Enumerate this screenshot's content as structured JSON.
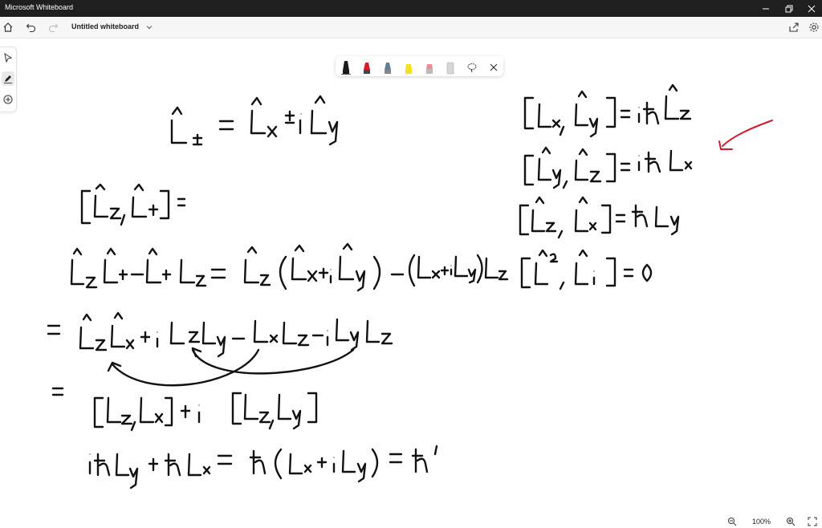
{
  "window": {
    "title": "Microsoft Whiteboard"
  },
  "toolbar": {
    "doc_title": "Untitled whiteboard"
  },
  "zoom": {
    "level": "100%"
  },
  "colors": {
    "ink": "#111111",
    "annotation_arrow": "#d01a2a",
    "titlebar": "#1f1f1f"
  },
  "pens": [
    {
      "name": "black-pen",
      "color": "#1a1a1a"
    },
    {
      "name": "red-pen",
      "color": "#d81b2b"
    },
    {
      "name": "blue-gray-pen",
      "color": "#5e7f95"
    },
    {
      "name": "yellow-highlighter",
      "color": "#f4e31a"
    },
    {
      "name": "pink-highlighter",
      "color": "#f08a95"
    },
    {
      "name": "eraser",
      "color": "#cfcfcf"
    }
  ]
}
